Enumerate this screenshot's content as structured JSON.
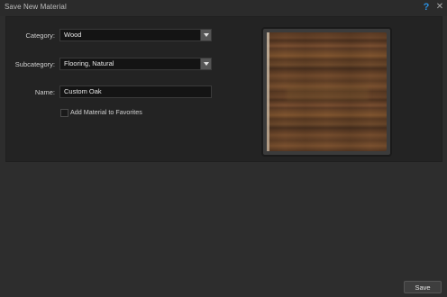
{
  "window": {
    "title": "Save New Material",
    "help_icon": "?",
    "close_icon": "✕"
  },
  "form": {
    "category_label": "Category:",
    "category_value": "Wood",
    "subcategory_label": "Subcategory:",
    "subcategory_value": "Flooring, Natural",
    "name_label": "Name:",
    "name_value": "Custom Oak",
    "favorites_label": "Add Material to Favorites",
    "favorites_checked": false
  },
  "preview": {
    "icon": "wood-material-preview"
  },
  "footer": {
    "save_label": "Save"
  }
}
